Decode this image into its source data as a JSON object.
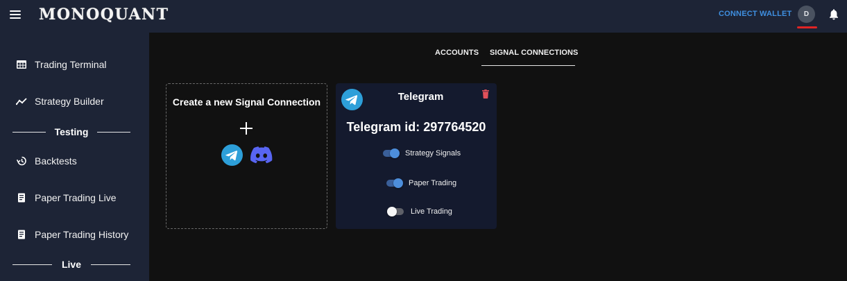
{
  "header": {
    "logo": "MONOQUANT",
    "connect_wallet": "CONNECT WALLET",
    "avatar_initial": "D"
  },
  "sidebar": {
    "items": [
      {
        "label": "Trading Terminal",
        "icon": "table-icon"
      },
      {
        "label": "Strategy Builder",
        "icon": "chart-line-icon"
      },
      {
        "label": "Backtests",
        "icon": "history-icon"
      },
      {
        "label": "Paper Trading Live",
        "icon": "receipt-icon"
      },
      {
        "label": "Paper Trading History",
        "icon": "receipt-icon"
      }
    ],
    "sections": [
      "Testing",
      "Live"
    ]
  },
  "tabs": [
    {
      "label": "ACCOUNTS",
      "active": false
    },
    {
      "label": "SIGNAL CONNECTIONS",
      "active": true
    }
  ],
  "create_card": {
    "title": "Create a new Signal Connection",
    "icons": [
      "plus-icon",
      "telegram-icon",
      "discord-icon"
    ]
  },
  "telegram_card": {
    "title": "Telegram",
    "id_text": "Telegram id: 297764520",
    "toggles": [
      {
        "label": "Strategy Signals",
        "on": true
      },
      {
        "label": "Paper Trading",
        "on": true
      },
      {
        "label": "Live Trading",
        "on": false
      }
    ]
  },
  "colors": {
    "bar_bg": "#1d2436",
    "page_bg": "#111111",
    "card_bg": "#141a2e",
    "accent_blue": "#3f8fe0",
    "telegram_blue": "#2d9fd9",
    "discord_purple": "#5865f2",
    "danger_red": "#e0505a"
  }
}
